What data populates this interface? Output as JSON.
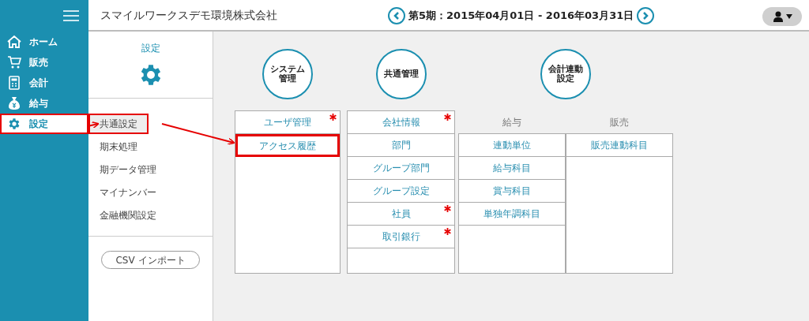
{
  "header": {
    "company": "スマイルワークスデモ環境株式会社",
    "period": "第5期：2015年04月01日 - 2016年03月31日"
  },
  "nav": [
    {
      "label": "ホーム",
      "selected": false,
      "highlighted": false
    },
    {
      "label": "販売",
      "selected": false,
      "highlighted": false
    },
    {
      "label": "会計",
      "selected": false,
      "highlighted": false
    },
    {
      "label": "給与",
      "selected": false,
      "highlighted": false
    },
    {
      "label": "設定",
      "selected": true,
      "highlighted": true
    }
  ],
  "panel": {
    "title": "設定",
    "menu": [
      {
        "label": "共通設定",
        "selected": true,
        "highlighted": true
      },
      {
        "label": "期末処理",
        "selected": false,
        "highlighted": false
      },
      {
        "label": "期データ管理",
        "selected": false,
        "highlighted": false
      },
      {
        "label": "マイナンバー",
        "selected": false,
        "highlighted": false
      },
      {
        "label": "金融機関設定",
        "selected": false,
        "highlighted": false
      }
    ],
    "import_button": "CSV インポート"
  },
  "groups": [
    {
      "title": "システム管理",
      "sections": [
        {
          "items": [
            {
              "label": "ユーザ管理",
              "required": true,
              "highlighted": false
            },
            {
              "label": "アクセス履歴",
              "required": false,
              "highlighted": true
            }
          ]
        }
      ]
    },
    {
      "title": "共通管理",
      "sections": [
        {
          "items": [
            {
              "label": "会社情報",
              "required": true,
              "highlighted": false
            },
            {
              "label": "部門",
              "required": false,
              "highlighted": false
            },
            {
              "label": "グループ部門",
              "required": false,
              "highlighted": false
            },
            {
              "label": "グループ設定",
              "required": false,
              "highlighted": false
            },
            {
              "label": "社員",
              "required": true,
              "highlighted": false
            },
            {
              "label": "取引銀行",
              "required": true,
              "highlighted": false
            }
          ]
        }
      ]
    },
    {
      "title": "会計連動設定",
      "sections": [
        {
          "title": "給与",
          "items": [
            {
              "label": "連動単位",
              "required": false,
              "highlighted": false
            },
            {
              "label": "給与科目",
              "required": false,
              "highlighted": false
            },
            {
              "label": "賞与科目",
              "required": false,
              "highlighted": false
            },
            {
              "label": "単独年調科目",
              "required": false,
              "highlighted": false
            }
          ]
        },
        {
          "title": "販売",
          "items": [
            {
              "label": "販売連動科目",
              "required": false,
              "highlighted": false
            }
          ]
        }
      ]
    }
  ]
}
